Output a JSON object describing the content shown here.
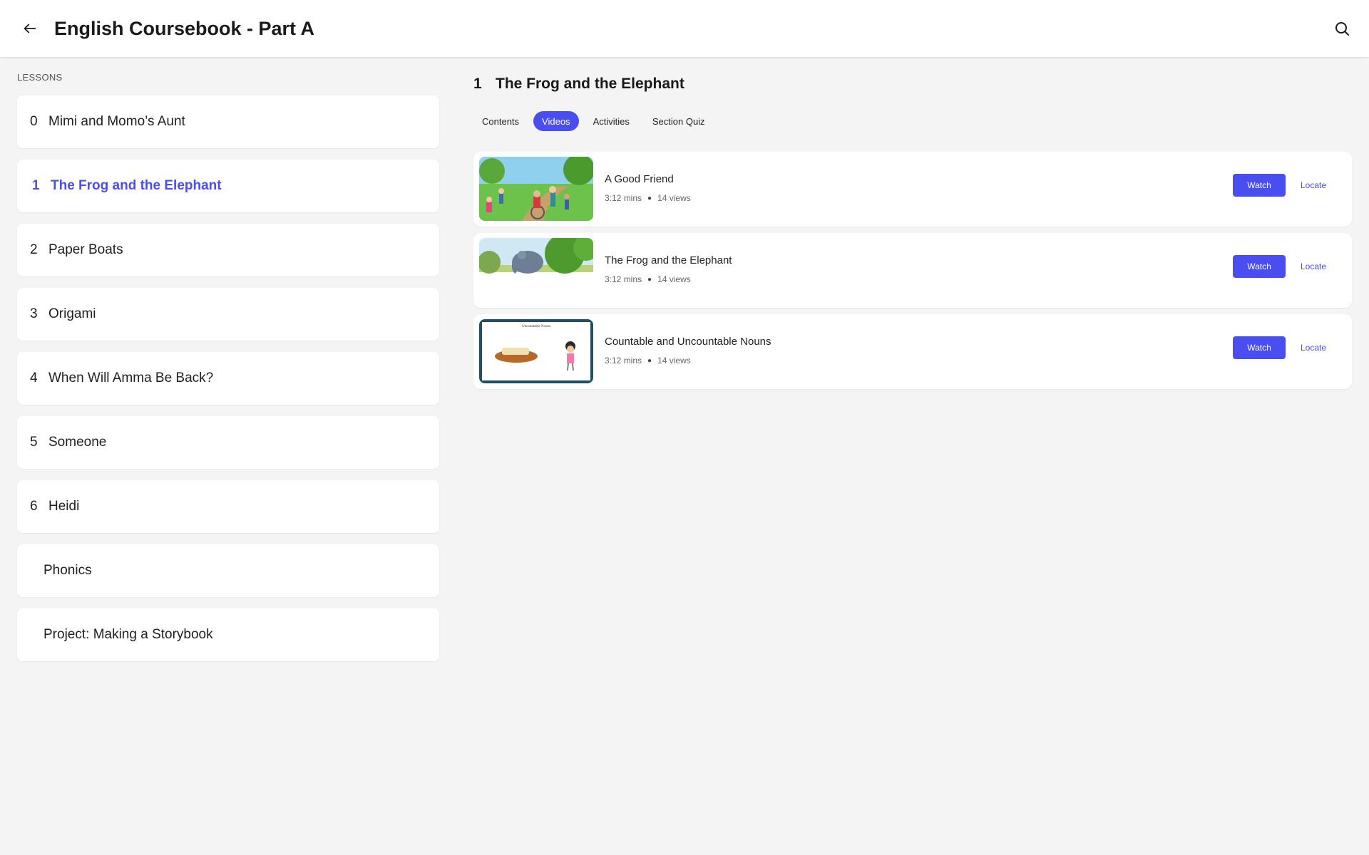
{
  "header": {
    "title": "English Coursebook - Part A",
    "back_icon": "arrow-left-icon",
    "search_icon": "search-icon"
  },
  "sidebar": {
    "heading": "LESSONS",
    "lessons": [
      {
        "num": "0",
        "label": "Mimi and Momo’s Aunt"
      },
      {
        "num": "1",
        "label": "The Frog and the Elephant",
        "active": true
      },
      {
        "num": "2",
        "label": "Paper Boats"
      },
      {
        "num": "3",
        "label": "Origami"
      },
      {
        "num": "4",
        "label": "When Will Amma Be Back?"
      },
      {
        "num": "5",
        "label": "Someone"
      },
      {
        "num": "6",
        "label": "Heidi"
      },
      {
        "num": "",
        "label": "Phonics"
      },
      {
        "num": "",
        "label": "Project: Making a Storybook"
      }
    ]
  },
  "main": {
    "section_number": "1",
    "section_title": "The Frog and the Elephant",
    "tabs": [
      {
        "label": "Contents"
      },
      {
        "label": "Videos",
        "active": true
      },
      {
        "label": "Activities"
      },
      {
        "label": "Section Quiz"
      }
    ],
    "videos": [
      {
        "title": "A Good Friend",
        "duration": "3:12 mins",
        "views": "14 views",
        "watch_label": "Watch",
        "locate_label": "Locate"
      },
      {
        "title": "The Frog and the Elephant",
        "duration": "3:12 mins",
        "views": "14 views",
        "watch_label": "Watch",
        "locate_label": "Locate"
      },
      {
        "title": "Countable and Uncountable Nouns",
        "duration": "3:12 mins",
        "views": "14 views",
        "watch_label": "Watch",
        "locate_label": "Locate",
        "thumb_caption": "Uncountable Nouns"
      }
    ]
  },
  "colors": {
    "accent": "#4a4ef0",
    "background": "#f4f4f4",
    "card": "#ffffff"
  }
}
